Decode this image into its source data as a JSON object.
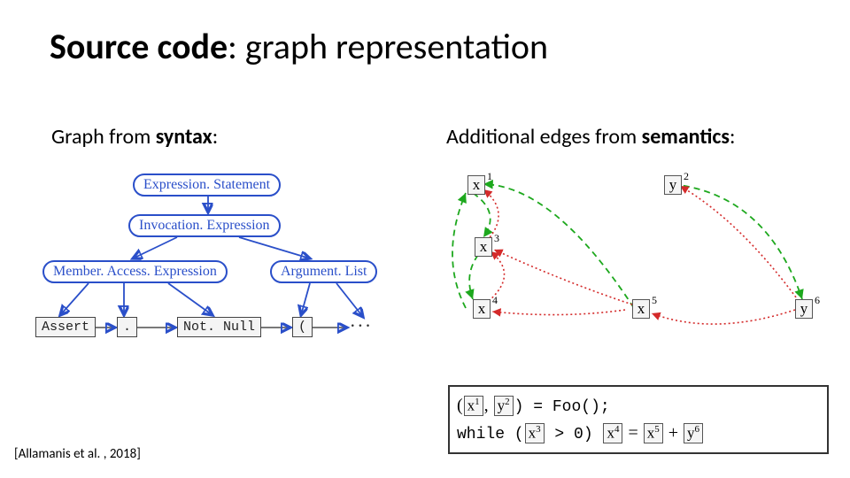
{
  "title": {
    "bold": "Source code",
    "rest": ": graph representation"
  },
  "sub": {
    "left_pre": "Graph from ",
    "left_b": "syntax",
    "left_post": ":",
    "right_pre": "Additional edges from ",
    "right_b": "semantics",
    "right_post": ":"
  },
  "citation": "[Allamanis et al. , 2018]",
  "syntax": {
    "n1": "Expression. Statement",
    "n2": "Invocation. Expression",
    "n3": "Member. Access. Expression",
    "n4": "Argument. List",
    "leaf_assert": "Assert",
    "leaf_dot": ".",
    "leaf_notnull": "Not. Null",
    "leaf_paren": "(",
    "ellipsis": "· · ·"
  },
  "sem": {
    "x": "x",
    "y": "y",
    "sup1": "1",
    "sup2": "2",
    "sup3": "3",
    "sup4": "4",
    "sup5": "5",
    "sup6": "6"
  },
  "code": {
    "l1a": "(",
    "l1b": ",",
    "l1c": ") = Foo();",
    "l2a": "while (",
    "l2b": " > 0) ",
    "l2c": " = ",
    "l2d": " + "
  }
}
